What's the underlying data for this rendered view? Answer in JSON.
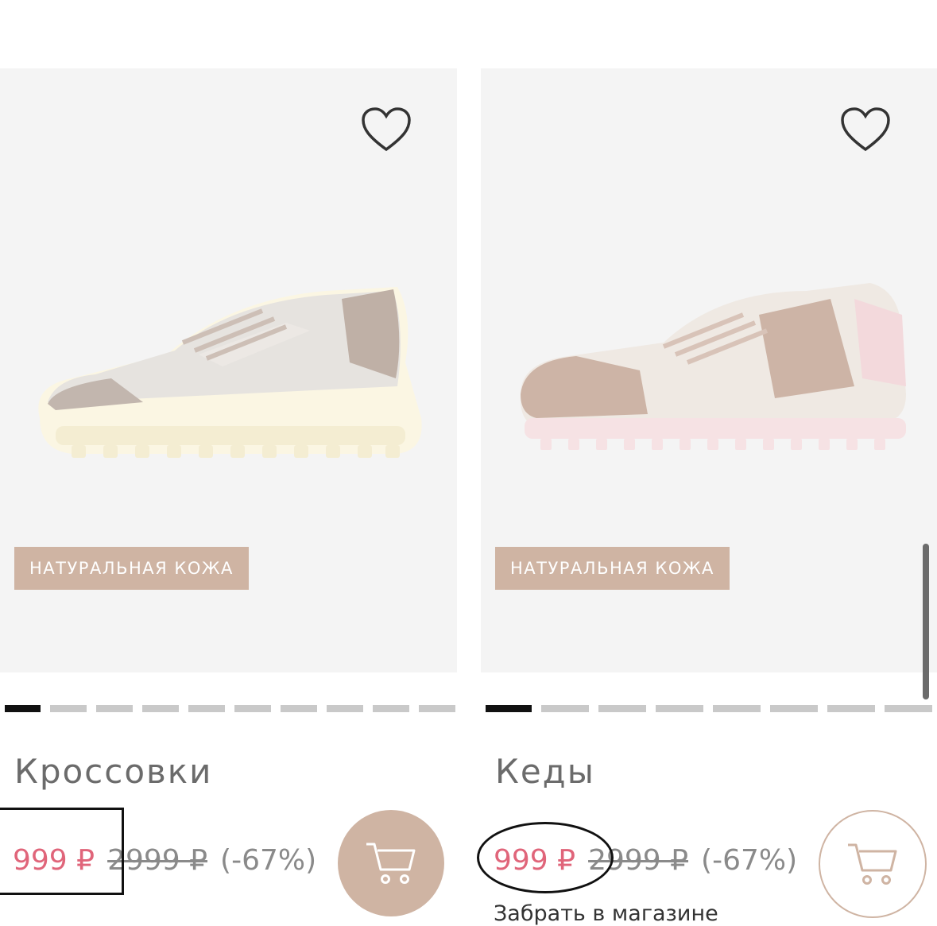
{
  "products": [
    {
      "name": "Кроссовки",
      "badge": "НАТУРАЛЬНАЯ КОЖА",
      "price": "999 ₽",
      "old_price": "2999 ₽",
      "discount": "(-67%)",
      "images_count": 10,
      "active_image": 1,
      "favorite_icon": "heart-outline-icon",
      "cart_icon": "cart-icon"
    },
    {
      "name": "Кеды",
      "badge": "НАТУРАЛЬНАЯ КОЖА",
      "price": "999 ₽",
      "old_price": "2999 ₽",
      "discount": "(-67%)",
      "pickup": "Забрать в магазине",
      "images_count": 9,
      "active_image": 1,
      "favorite_icon": "heart-outline-icon",
      "cart_icon": "cart-icon"
    }
  ],
  "colors": {
    "accent": "#cfb4a3",
    "sale_price": "#e0657a",
    "muted_text": "#8a8a8a"
  }
}
